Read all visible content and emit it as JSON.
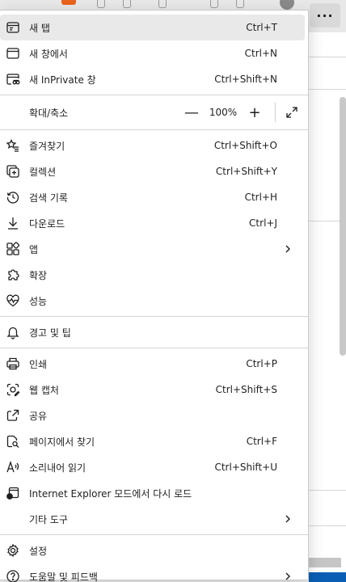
{
  "browser": {
    "more_button_label": "···"
  },
  "menu": {
    "group1": [
      {
        "name": "new-tab",
        "icon": "new-tab-icon",
        "label": "새 탭",
        "shortcut": "Ctrl+T"
      },
      {
        "name": "new-window",
        "icon": "new-window-icon",
        "label": "새 창에서",
        "shortcut": "Ctrl+N"
      },
      {
        "name": "new-inprivate",
        "icon": "inprivate-icon",
        "label": "새 InPrivate 창",
        "shortcut": "Ctrl+Shift+N"
      }
    ],
    "zoom": {
      "label": "확대/축소",
      "minus": "—",
      "value": "100%",
      "plus": "+"
    },
    "group2": [
      {
        "name": "favorites",
        "icon": "star-list-icon",
        "label": "즐겨찾기",
        "shortcut": "Ctrl+Shift+O"
      },
      {
        "name": "collections",
        "icon": "collections-icon",
        "label": "컬렉션",
        "shortcut": "Ctrl+Shift+Y"
      },
      {
        "name": "history",
        "icon": "history-icon",
        "label": "검색 기록",
        "shortcut": "Ctrl+H"
      },
      {
        "name": "downloads",
        "icon": "download-icon",
        "label": "다운로드",
        "shortcut": "Ctrl+J"
      },
      {
        "name": "apps",
        "icon": "apps-icon",
        "label": "앱",
        "shortcut": ""
      },
      {
        "name": "extensions",
        "icon": "puzzle-icon",
        "label": "확장",
        "shortcut": ""
      },
      {
        "name": "performance",
        "icon": "heartbeat-icon",
        "label": "성능",
        "shortcut": ""
      }
    ],
    "group3": [
      {
        "name": "alerts-tips",
        "icon": "bell-icon",
        "label": "경고 및 팁",
        "shortcut": ""
      }
    ],
    "group4": [
      {
        "name": "print",
        "icon": "printer-icon",
        "label": "인쇄",
        "shortcut": "Ctrl+P"
      },
      {
        "name": "web-capture",
        "icon": "capture-icon",
        "label": "웹 캡처",
        "shortcut": "Ctrl+Shift+S"
      },
      {
        "name": "share",
        "icon": "share-icon",
        "label": "공유",
        "shortcut": ""
      },
      {
        "name": "find-on-page",
        "icon": "find-icon",
        "label": "페이지에서 찾기",
        "shortcut": "Ctrl+F"
      },
      {
        "name": "read-aloud",
        "icon": "read-aloud-icon",
        "label": "소리내어 읽기",
        "shortcut": "Ctrl+Shift+U"
      },
      {
        "name": "ie-mode",
        "icon": "ie-icon",
        "label": "Internet Explorer 모드에서 다시 로드",
        "shortcut": ""
      },
      {
        "name": "more-tools",
        "icon": "",
        "label": "기타 도구",
        "shortcut": ""
      }
    ],
    "group5": [
      {
        "name": "settings",
        "icon": "gear-icon",
        "label": "설정",
        "shortcut": ""
      },
      {
        "name": "help-feedback",
        "icon": "help-icon",
        "label": "도움말 및 피드백",
        "shortcut": ""
      }
    ]
  },
  "colors": {
    "hover_bg": "#e9e9e9",
    "menu_bg": "#ffffff",
    "separator": "#d4d4d4",
    "text": "#1f1f1f"
  }
}
